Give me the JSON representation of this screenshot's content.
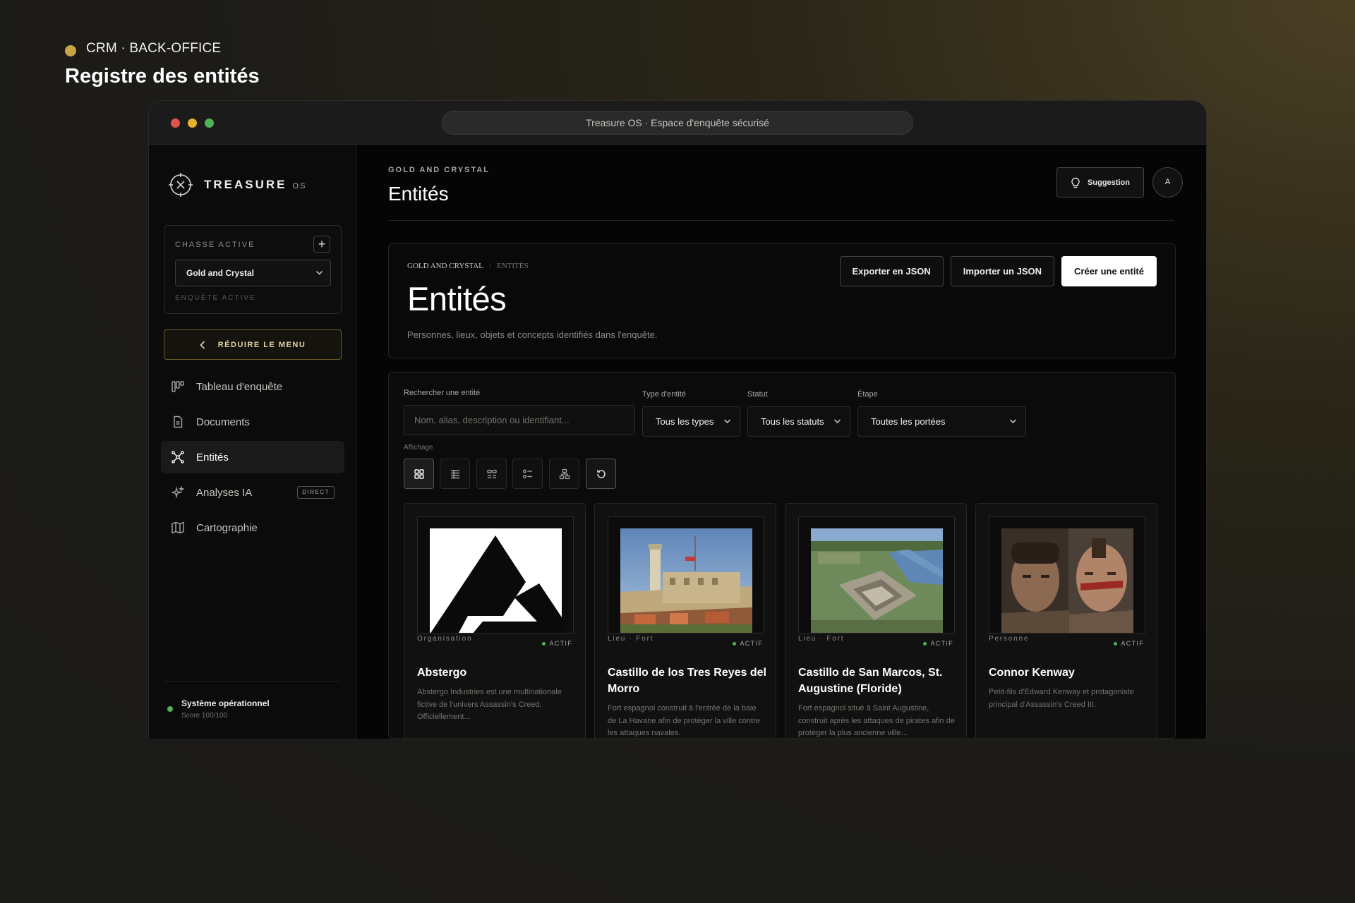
{
  "hero": {
    "tag": "CRM · BACK-OFFICE",
    "title": "Registre des entités"
  },
  "window": {
    "url_title": "Treasure OS · Espace d'enquête sécurisé"
  },
  "sidebar": {
    "brand": "TREASURE",
    "brand_suffix": "OS",
    "hunt_label": "CHASSE ACTIVE",
    "hunt_value": "Gold and Crystal",
    "hunt_status": "ENQUÊTE ACTIVE",
    "collapse_label": "RÉDUIRE LE MENU",
    "items": [
      {
        "label": "Tableau d'enquête",
        "icon": "board-icon"
      },
      {
        "label": "Documents",
        "icon": "document-icon"
      },
      {
        "label": "Entités",
        "icon": "entities-icon",
        "active": true
      },
      {
        "label": "Analyses IA",
        "icon": "sparkle-icon",
        "badge": "DIRECT"
      },
      {
        "label": "Cartographie",
        "icon": "map-icon"
      }
    ],
    "system_title": "Système opérationnel",
    "system_score": "Score 100/100"
  },
  "topbar": {
    "kicker": "GOLD AND CRYSTAL",
    "title": "Entités",
    "suggestion_label": "Suggestion",
    "avatar_initial": "A"
  },
  "header": {
    "crumb_root": "GOLD AND CRYSTAL",
    "crumb_sep": "/",
    "crumb_current": "ENTITÉS",
    "title": "Entités",
    "description": "Personnes, lieux, objets et concepts identifiés dans l'enquête.",
    "export_label": "Exporter en JSON",
    "import_label": "Importer un JSON",
    "create_label": "Créer une entité"
  },
  "filters": {
    "search_label": "Rechercher une entité",
    "search_placeholder": "Nom, alias, description ou identifiant...",
    "type_label": "Type d'entité",
    "type_value": "Tous les types",
    "status_label": "Statut",
    "status_value": "Tous les statuts",
    "stage_label": "Étape",
    "stage_value": "Toutes les portées",
    "view_label": "Affichage"
  },
  "entities": [
    {
      "type": "Organisation",
      "status": "ACTIF",
      "name": "Abstergo",
      "description": "Abstergo Industries est une multinationale fictive de l'univers Assassin's Creed. Officiellement..."
    },
    {
      "type": "Lieu · Fort",
      "status": "ACTIF",
      "name": "Castillo de los Tres Reyes del Morro",
      "description": "Fort espagnol construit à l'entrée de la baie de La Havane afin de protéger la ville contre les attaques navales."
    },
    {
      "type": "Lieu · Fort",
      "status": "ACTIF",
      "name": "Castillo de San Marcos, St. Augustine (Floride)",
      "description": "Fort espagnol situé à Saint Augustine, construit après les attaques de pirates afin de protéger la plus ancienne ville..."
    },
    {
      "type": "Personne",
      "status": "ACTIF",
      "name": "Connor Kenway",
      "description": "Petit-fils d'Edward Kenway et protagoniste principal d'Assassin's Creed III."
    }
  ],
  "colors": {
    "accent_gold": "#c9a445",
    "status_green": "#4fb458",
    "primary_button": "#ffffff"
  }
}
